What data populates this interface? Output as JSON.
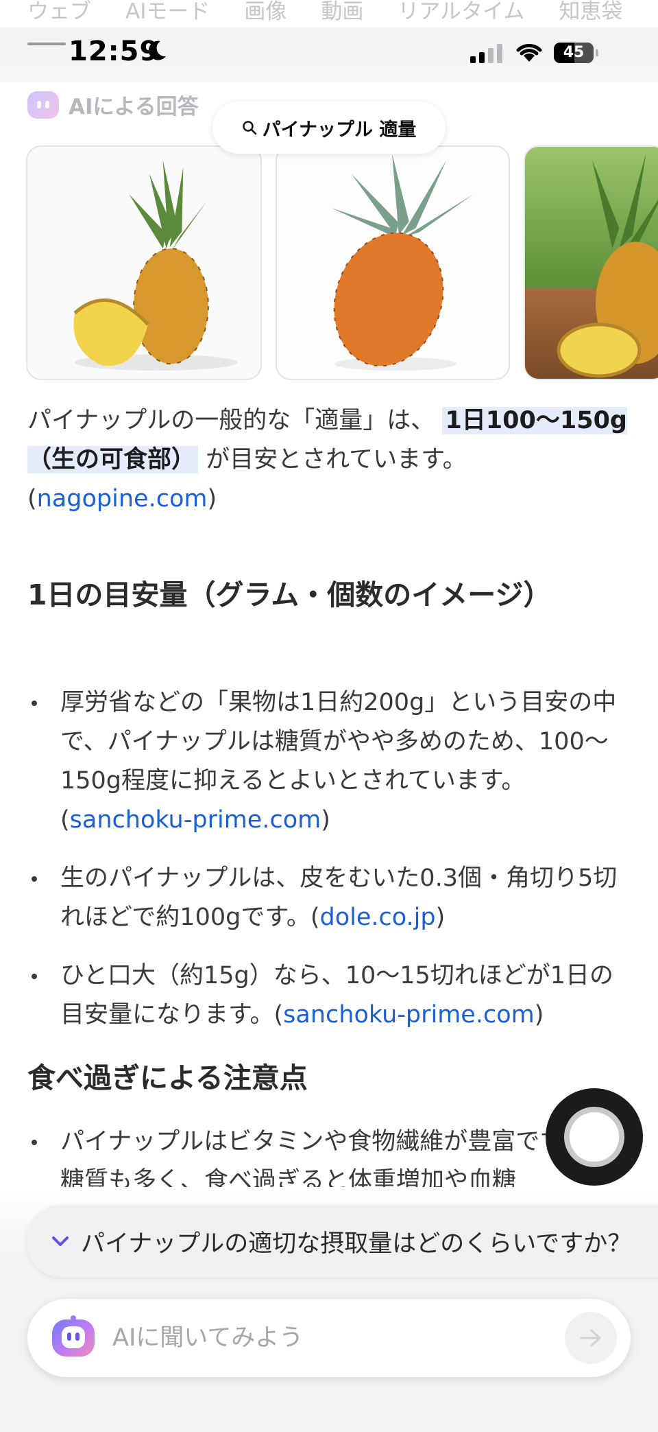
{
  "tabs": [
    "ウェブ",
    "AIモード",
    "画像",
    "動画",
    "リアルタイム",
    "知恵袋"
  ],
  "status": {
    "time": "12:59",
    "battery": "45"
  },
  "ai_header": {
    "label": "AIによる回答"
  },
  "query": {
    "text": "パイナップル 適量"
  },
  "intro": {
    "prefix": "パイナップルの一般的な「適量」は、",
    "highlight": "1日100〜150g（生の可食部）",
    "suffix": "が目安とされています。",
    "source": "nagopine.com"
  },
  "sections": {
    "amount": {
      "heading": "1日の目安量（グラム・個数のイメージ）",
      "items": [
        {
          "text": "厚労省などの「果物は1日約200g」という目安の中で、パイナップルは糖質がやや多めのため、100〜150g程度に抑えるとよいとされています。",
          "source": "sanchoku-prime.com"
        },
        {
          "text": "生のパイナップルは、皮をむいた0.3個・角切り5切れほどで約100gです。",
          "source": "dole.co.jp"
        },
        {
          "text": "ひと口大（約15g）なら、10〜15切れほどが1日の目安量になります。",
          "source": "sanchoku-prime.com"
        }
      ]
    },
    "caution": {
      "heading": "食べ過ぎによる注意点",
      "items": [
        {
          "text": "パイナップルはビタミンや食物繊維が豊富ですが、糖質も多く、食べ過ぎると体重増加や血糖"
        }
      ]
    }
  },
  "suggestion": {
    "text": "パイナップルの適切な摂取量はどのくらいですか？"
  },
  "ask": {
    "placeholder": "AIに聞いてみよう"
  },
  "colors": {
    "link": "#1a5fd6",
    "highlight": "#e4ebfb",
    "suggestion_check": "#6a4de0"
  }
}
